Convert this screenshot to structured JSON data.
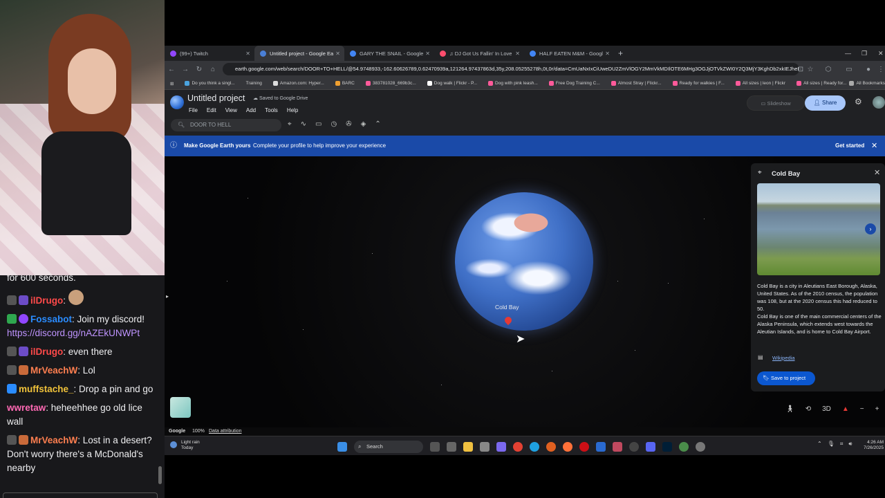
{
  "chat": {
    "partial_line": "for 600 seconds.",
    "messages": [
      {
        "user": "ilDrugo",
        "user_color": "#ff4a4a",
        "text": ":"
      },
      {
        "user": "Fossabot",
        "user_color": "#2a8cff",
        "text": ": Join my discord!",
        "link": "https://discord.gg/nAZEkUNWPt"
      },
      {
        "user": "ilDrugo",
        "user_color": "#ff4a4a",
        "text": ": even there"
      },
      {
        "user": "MrVeachW",
        "user_color": "#ff7f50",
        "text": ": Lol"
      },
      {
        "user": "muffstache_",
        "user_color": "#f0c23a",
        "text": ": Drop a pin and go"
      },
      {
        "user": "wwretaw",
        "user_color": "#ff69b4",
        "text": ": heheehhee go old lice wall"
      },
      {
        "user": "MrVeachW",
        "user_color": "#ff7f50",
        "text": ": Lost in a desert? Don't worry there's a McDonald's nearby"
      }
    ]
  },
  "browser": {
    "tabs": [
      {
        "label": "(99+) Twitch",
        "color": "#9146ff"
      },
      {
        "label": "Untitled project - Google Earth",
        "color": "#4a7fd6"
      },
      {
        "label": "GARY THE SNAIL - Google Search",
        "color": "#4285f4"
      },
      {
        "label": "♫ DJ Got Us Fallin' In Love | Us",
        "color": "#ff4d6d"
      },
      {
        "label": "HALF EATEN M&M - Google Search",
        "color": "#4285f4"
      }
    ],
    "new_tab": "+",
    "url": "earth.google.com/web/search/DOOR+TO+HELL/@54.9748933,-162.60626789,0.62470939a,121264.97437863d,35y,208.05255278h,0t,0r/data=CmUaNxIxCiUweDU2ZmVlOGY2MmVkMDIlOTE6MHg3OGJjOTVkZWI0Y2Q3MjY3KghDb2xkIEJheRgCIAEiJgokCdRm...",
    "bookmarks": [
      "Do you think a singl...",
      "Training",
      "Amazon.com: Hyper...",
      "BARC",
      "383781028_669b3c...",
      "Dog walk | Flickr - P...",
      "Dog with pink leash...",
      "Free Dog Training C...",
      "Almost Stray | Flickr...",
      "Ready for walkies | F...",
      "All sizes | leon | Flickr",
      "All sizes | Ready for...",
      "All Bookmarks"
    ]
  },
  "earth": {
    "title": "Untitled project",
    "saved_status": "Saved to Google Drive",
    "menu": [
      "File",
      "Edit",
      "View",
      "Add",
      "Tools",
      "Help"
    ],
    "search_value": "DOOR TO HELL",
    "slideshow_label": "Slideshow",
    "share_label": "Share",
    "banner": {
      "title": "Make Google Earth yours",
      "text": "Complete your profile to help improve your experience",
      "action": "Get started"
    },
    "map_label": "Cold Bay",
    "panel": {
      "title": "Cold Bay",
      "description_1": "Cold Bay is a city in Aleutians East Borough, Alaska, United States. As of the 2010 census, the population was 108, but at the 2020 census this had reduced to 50.",
      "description_2": "Cold Bay is one of the main commercial centers of the Alaska Peninsula, which extends west towards the Aleutian Islands, and is home to Cold Bay Airport.",
      "source_link": "Wikipedia",
      "save_label": "Save to project"
    },
    "view_mode": "3D",
    "footer": {
      "brand": "Google",
      "zoom": "100%",
      "attribution": "Data attribution"
    }
  },
  "taskbar": {
    "weather_condition": "Light rain",
    "weather_day": "Today",
    "search_label": "Search",
    "time": "4:26 AM",
    "date": "7/26/2025"
  }
}
